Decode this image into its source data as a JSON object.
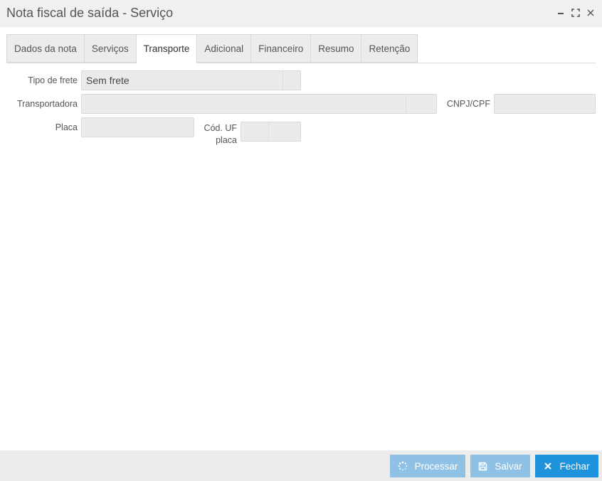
{
  "window": {
    "title": "Nota fiscal de saída - Serviço",
    "controls": [
      "minimize-icon",
      "maximize-icon",
      "close-icon"
    ]
  },
  "tabs": [
    {
      "label": "Dados da nota",
      "active": false
    },
    {
      "label": "Serviços",
      "active": false
    },
    {
      "label": "Transporte",
      "active": true
    },
    {
      "label": "Adicional",
      "active": false
    },
    {
      "label": "Financeiro",
      "active": false
    },
    {
      "label": "Resumo",
      "active": false
    },
    {
      "label": "Retenção",
      "active": false
    }
  ],
  "form": {
    "tipo_frete": {
      "label": "Tipo de frete",
      "value": "Sem frete"
    },
    "transportadora": {
      "label": "Transportadora",
      "value": ""
    },
    "cnpj_cpf": {
      "label": "CNPJ/CPF",
      "value": ""
    },
    "placa": {
      "label": "Placa",
      "value": ""
    },
    "cod_uf_placa": {
      "label_line1": "Cód. UF",
      "label_line2": "placa",
      "value": ""
    }
  },
  "footer": {
    "processar_label": "Processar",
    "salvar_label": "Salvar",
    "fechar_label": "Fechar"
  },
  "colors": {
    "primary": "#1e92da",
    "disabled_button": "#8fc1e4",
    "field_bg": "#ebebeb"
  }
}
